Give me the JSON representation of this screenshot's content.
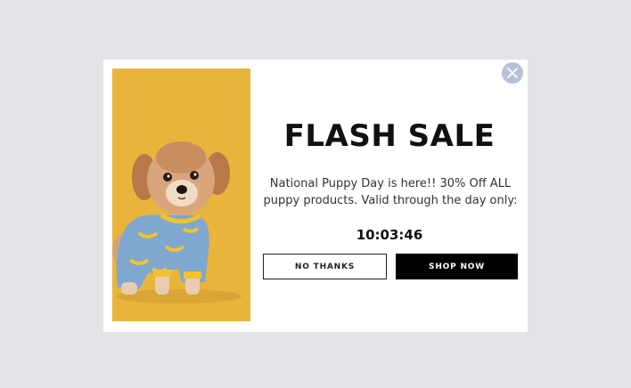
{
  "popup": {
    "title": "FLASH SALE",
    "message": "National Puppy Day is here!! 30% Off ALL puppy products. Valid through the day only:",
    "countdown": "10:03:46",
    "decline_label": "NO THANKS",
    "cta_label": "SHOP NOW",
    "close_icon": "close-icon",
    "image": "puppy-in-banana-shirt"
  },
  "colors": {
    "backdrop": "#e3e3e8",
    "photo_background": "#e8b43c",
    "close_button": "#b8c2d6",
    "cta_background": "#000000"
  }
}
